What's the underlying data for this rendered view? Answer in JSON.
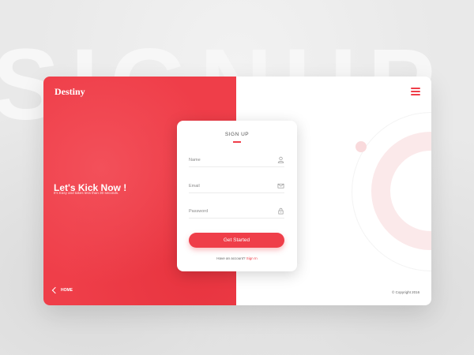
{
  "background": {
    "watermark": "SIGNUP"
  },
  "brand": {
    "name": "Destiny"
  },
  "hero": {
    "title": "Let's Kick Now !",
    "subtitle": "It's Easy and takes less than 30 seconds."
  },
  "nav": {
    "home_label": "HOME",
    "menu_icon": "hamburger-icon"
  },
  "form": {
    "title": "SIGN UP",
    "fields": {
      "name": {
        "placeholder": "Name",
        "value": "",
        "icon": "user-icon"
      },
      "email": {
        "placeholder": "Email",
        "value": "",
        "icon": "envelope-icon"
      },
      "password": {
        "placeholder": "Password",
        "value": "",
        "icon": "lock-icon"
      }
    },
    "submit_label": "Get Started",
    "signin_prompt": "Have an account?",
    "signin_link": "Sign In"
  },
  "footer": {
    "copyright": "© Copyright 2016"
  },
  "colors": {
    "accent": "#ef3e49",
    "soft_accent": "#fbe9ea",
    "background": "#ebebeb"
  }
}
